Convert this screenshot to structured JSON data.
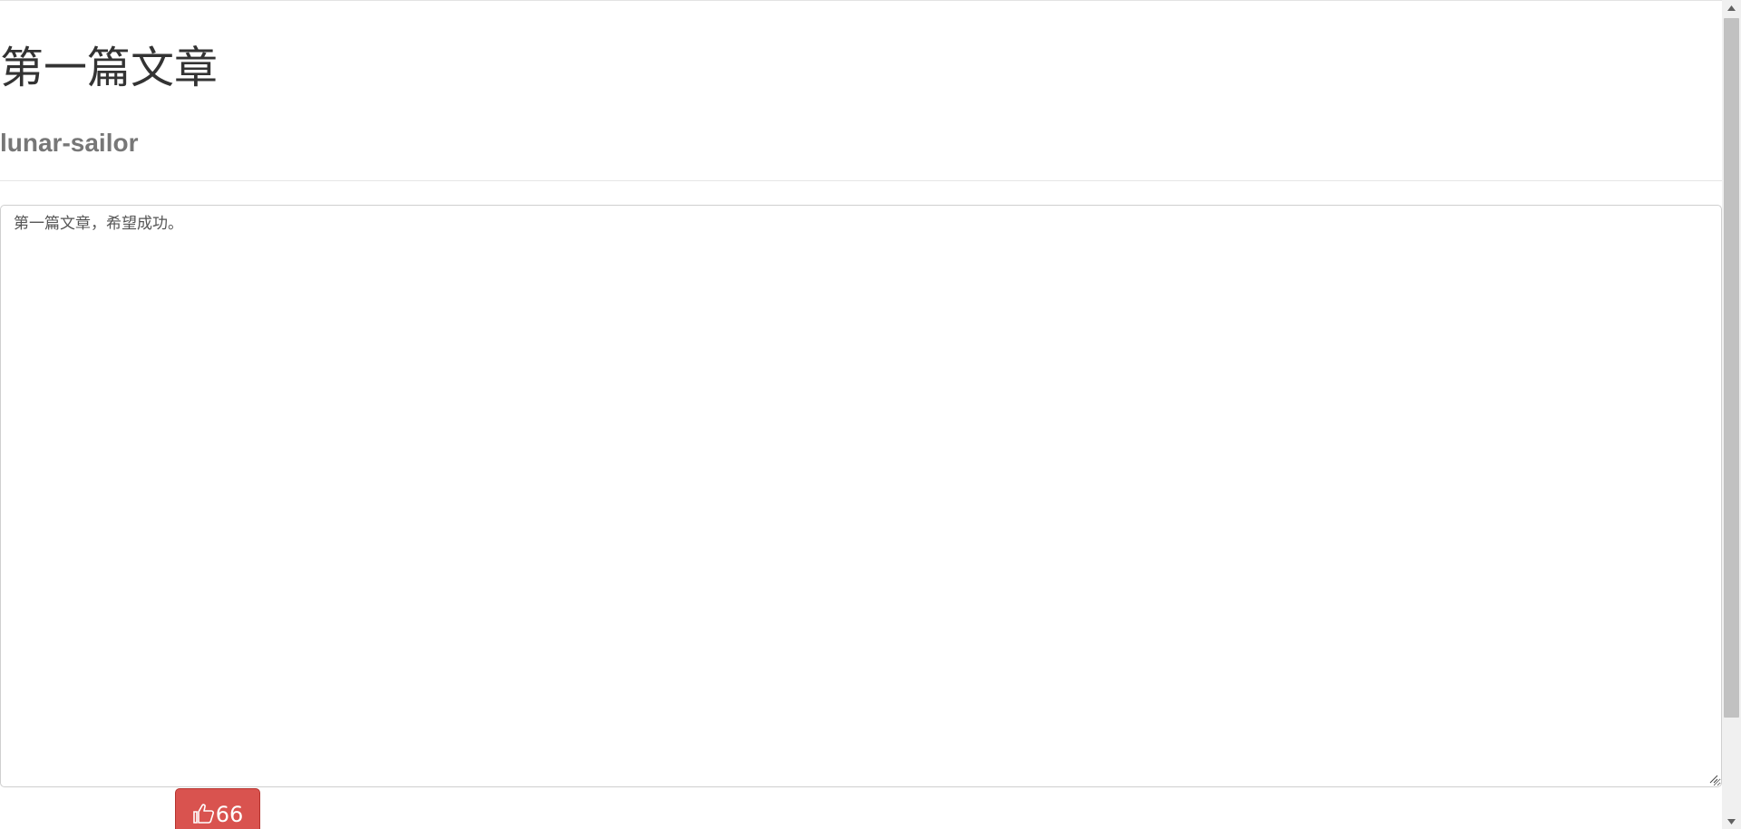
{
  "article": {
    "title": "第一篇文章",
    "author": "lunar-sailor",
    "content": "第一篇文章，希望成功。"
  },
  "like": {
    "count": "66",
    "icon": "thumbs-up-icon",
    "color": "#d9534f"
  },
  "scrollbar": {
    "up_icon": "chevron-up-icon",
    "down_icon": "chevron-down-icon"
  }
}
